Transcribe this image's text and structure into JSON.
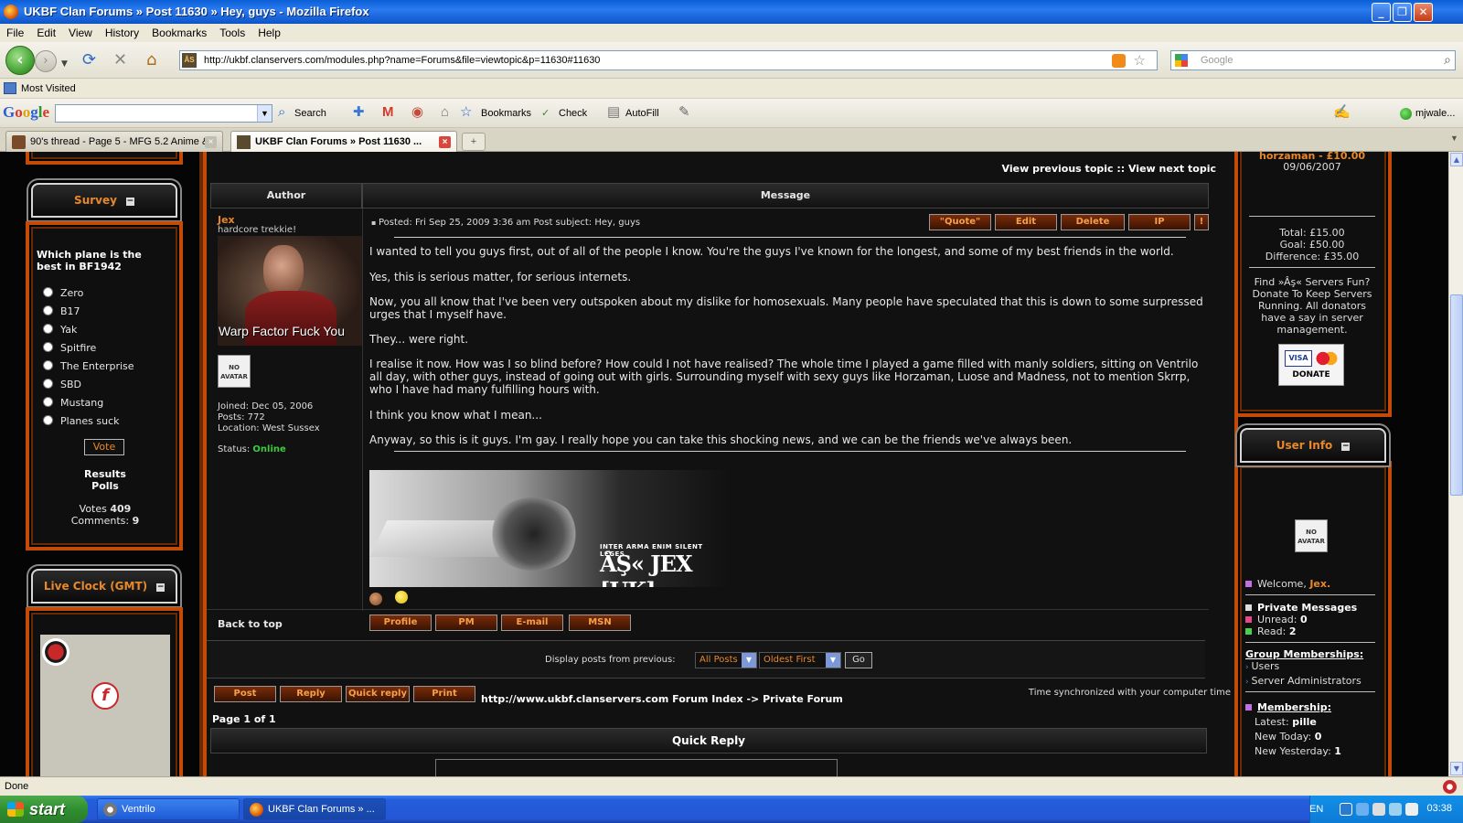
{
  "window": {
    "title": "UKBF Clan Forums » Post 11630 » Hey, guys - Mozilla Firefox"
  },
  "menu": [
    "File",
    "Edit",
    "View",
    "History",
    "Bookmarks",
    "Tools",
    "Help"
  ],
  "nav": {
    "url": "http://ukbf.clanservers.com/modules.php?name=Forums&file=viewtopic&p=11630#11630",
    "search_placeholder": "Google",
    "site_badge": "ÂS"
  },
  "bookmarks_bar": {
    "most_visited": "Most Visited"
  },
  "google_toolbar": {
    "logo": "Google",
    "search": "Search",
    "bookmarks": "Bookmarks",
    "check": "Check",
    "autofill": "AutoFill",
    "user": "mjwale..."
  },
  "tabs": [
    {
      "title": "90's thread - Page 5 - MFG 5.2 Anime &...",
      "active": false
    },
    {
      "title": "UKBF Clan Forums » Post 11630 ...",
      "active": true
    }
  ],
  "survey": {
    "heading": "Survey",
    "question": "Which plane is the best in BF1942",
    "options": [
      "Zero",
      "B17",
      "Yak",
      "Spitfire",
      "The Enterprise",
      "SBD",
      "Mustang",
      "Planes suck"
    ],
    "vote": "Vote",
    "results": "Results",
    "polls": "Polls",
    "votes_label": "Votes",
    "votes": "409",
    "comments_label": "Comments:",
    "comments": "9"
  },
  "clock": {
    "heading": "Live Clock (GMT)"
  },
  "topic": {
    "nav": "View previous topic :: View next topic",
    "author_header": "Author",
    "message_header": "Message"
  },
  "author": {
    "name": "Jex",
    "rank": "hardcore trekkie!",
    "avatar_caption": "Warp Factor Fuck You",
    "noavatar": "NO AVATAR",
    "joined": "Joined: Dec 05, 2006",
    "posts": "Posts: 772",
    "location": "Location: West Sussex",
    "status_label": "Status:",
    "status": "Online"
  },
  "post": {
    "posted": "Posted: Fri Sep 25, 2009 3:36 am Post subject: Hey, guys",
    "buttons": [
      "\"Quote\"",
      "Edit",
      "Delete",
      "IP",
      "!"
    ],
    "paragraphs": [
      "I wanted to tell you guys first, out of all of the people I know. You're the guys I've known for the longest, and some of my best friends in the world.",
      "Yes, this is serious matter, for serious internets.",
      "Now, you all know that I've been very outspoken about my dislike for homosexuals. Many people have speculated that this is down to some surpressed urges that I myself have.",
      "They... were right.",
      "I realise it now. How was I so blind before? How could I not have realised? The whole time I played a game filled with manly soldiers, sitting on Ventrilo all day, with other guys, instead of going out with girls. Surrounding myself with sexy guys like Horzaman, Luose and Madness, not to mention Skrrp, who I have had many fulfilling hours with.",
      "I think you know what I mean...",
      "Anyway, so this is it guys. I'm gay. I really hope you can take this shocking news, and we can be the friends we've always been."
    ],
    "sig_small": "INTER ARMA ENIM SILENT LEGES",
    "sig_big": "ÂŞ« JEX [UK]"
  },
  "post_footer": {
    "back_to_top": "Back to top",
    "buttons": [
      "Profile",
      "PM",
      "E-mail",
      "MSN"
    ]
  },
  "display": {
    "label": "Display posts from previous:",
    "filter": "All Posts",
    "order": "Oldest First",
    "go": "Go"
  },
  "actions": [
    "Post",
    "Reply",
    "Quick reply",
    "Print"
  ],
  "breadcrumb": "http://www.ukbf.clanservers.com Forum Index -> Private Forum",
  "time_sync": "Time synchronized with your computer time",
  "page": "Page 1 of 1",
  "quick_reply": "Quick Reply",
  "donations": {
    "donor": "horzaman - £10.00",
    "date": "09/06/2007",
    "total": "Total: £15.00",
    "goal": "Goal: £50.00",
    "difference": "Difference: £35.00",
    "blurb": "Find »Âş« Servers Fun? Donate To Keep Servers Running. All donators have a say in server management.",
    "visa": "VISA",
    "donate": "DONATE"
  },
  "user_info": {
    "heading": "User Info",
    "noavatar": "NO AVATAR",
    "welcome": "Welcome,",
    "user": "Jex.",
    "pm": "Private Messages",
    "unread_label": "Unread:",
    "unread": "0",
    "read_label": "Read:",
    "read": "2",
    "groups": "Group Memberships:",
    "group_list": [
      "Users",
      "Server Administrators"
    ],
    "membership": "Membership:",
    "latest_label": "Latest:",
    "latest": "pille",
    "today_label": "New Today:",
    "today": "0",
    "yesterday_label": "New Yesterday:",
    "yesterday": "1"
  },
  "status": {
    "text": "Done"
  },
  "taskbar": {
    "start": "start",
    "items": [
      "Ventrilo",
      "UKBF Clan Forums » ..."
    ],
    "lang": "EN",
    "clock": "03:38"
  },
  "colors": {
    "accent_orange": "#c44a08",
    "link_orange": "#e8882a",
    "online_green": "#3ec93e"
  }
}
